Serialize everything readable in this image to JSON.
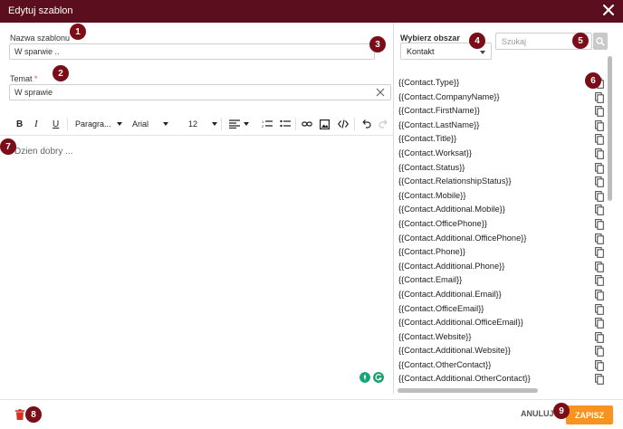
{
  "dialog": {
    "title": "Edytuj szablon"
  },
  "template_name": {
    "label": "Nazwa szablonu",
    "required_mark": "*",
    "value": "W sparwie .."
  },
  "subject": {
    "label": "Temat",
    "required_mark": "*",
    "value": "W sprawie"
  },
  "toolbar": {
    "bold": "B",
    "italic": "I",
    "underline": "U",
    "paragraph": "Paragra...",
    "font": "Arial",
    "size": "12"
  },
  "editor": {
    "content": "Dzien dobry ..."
  },
  "area": {
    "label": "Wybierz obszar",
    "selected": "Kontakt"
  },
  "search": {
    "placeholder": "Szukaj"
  },
  "variables": [
    "{{Contact.Type}}",
    "{{Contact.CompanyName}}",
    "{{Contact.FirstName}}",
    "{{Contact.LastName}}",
    "{{Contact.Title}}",
    "{{Contact.Worksat}}",
    "{{Contact.Status}}",
    "{{Contact.RelationshipStatus}}",
    "{{Contact.Mobile}}",
    "{{Contact.Additional.Mobile}}",
    "{{Contact.OfficePhone}}",
    "{{Contact.Additional.OfficePhone}}",
    "{{Contact.Phone}}",
    "{{Contact.Additional.Phone}}",
    "{{Contact.Email}}",
    "{{Contact.Additional.Email}}",
    "{{Contact.OfficeEmail}}",
    "{{Contact.Additional.OfficeEmail}}",
    "{{Contact.Website}}",
    "{{Contact.Additional.Website}}",
    "{{Contact.OtherContact}}",
    "{{Contact.Additional.OtherContact}}"
  ],
  "badges": [
    "1",
    "2",
    "3",
    "4",
    "5",
    "6",
    "7",
    "8",
    "9"
  ],
  "footer": {
    "cancel_label": "ANULUJ",
    "save_label": "ZAPISZ"
  },
  "colors": {
    "header": "#5b0f1e",
    "badge": "#7a0d17",
    "save": "#f7931e",
    "delete": "#d93025"
  }
}
